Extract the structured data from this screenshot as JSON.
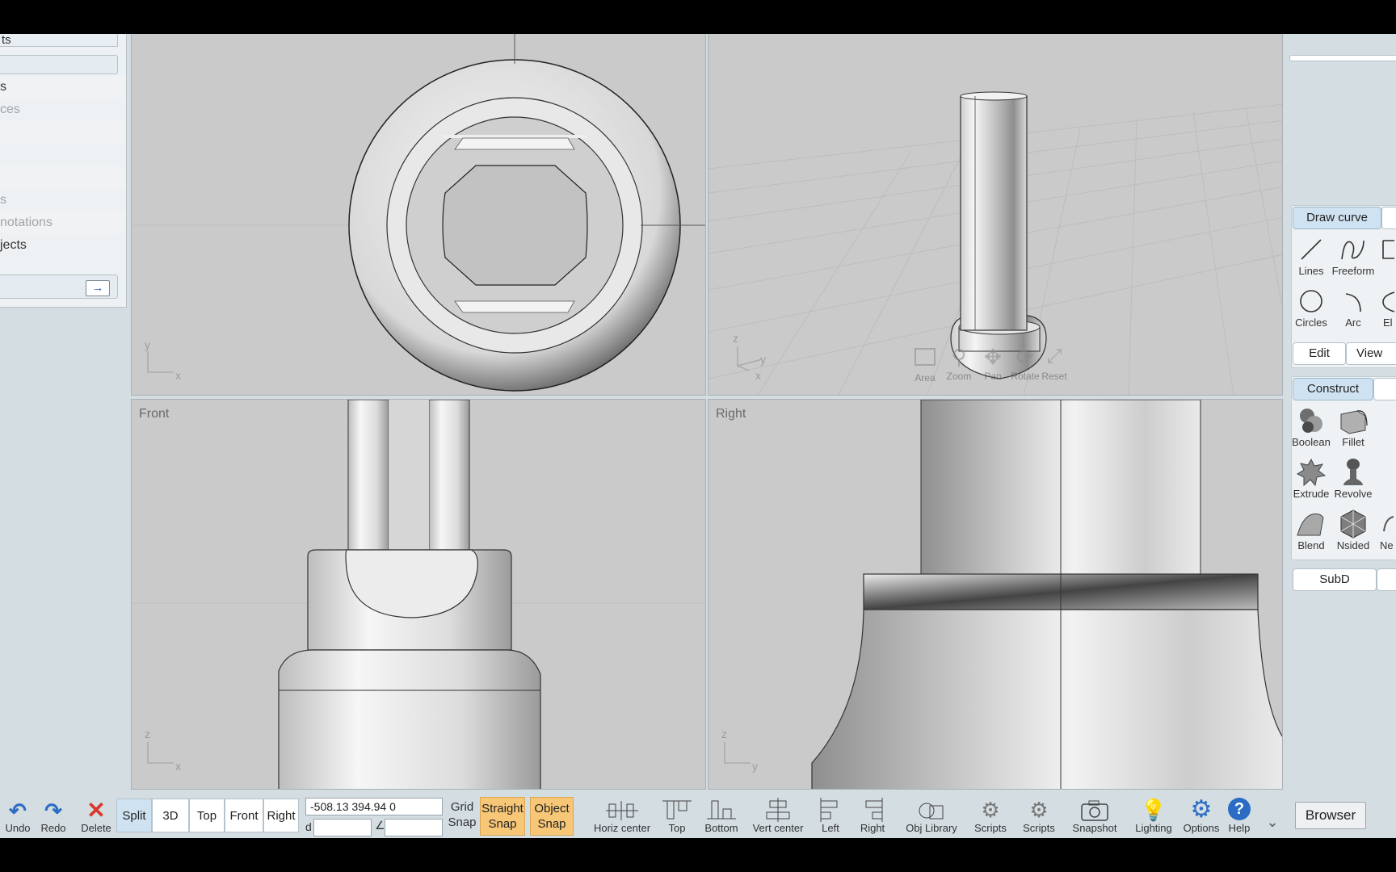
{
  "left_panel": {
    "tab_top": "ts",
    "rows": [
      "s",
      "ces",
      "",
      "",
      "",
      "s",
      "notations",
      "jects"
    ],
    "arrow": "→"
  },
  "viewports": {
    "top_left": {
      "label": "",
      "axis_x": "x",
      "axis_y": "y"
    },
    "top_right": {
      "label": "",
      "axis_x": "x",
      "axis_y": "y",
      "axis_z": "z",
      "nav": {
        "area": "Area",
        "zoom": "Zoom",
        "pan": "Pan",
        "rotate": "Rotate",
        "reset": "Reset"
      }
    },
    "front": {
      "label": "Front",
      "axis_x": "x",
      "axis_z": "z"
    },
    "right": {
      "label": "Right",
      "axis_y": "y",
      "axis_z": "z"
    }
  },
  "right_panel": {
    "draw_curve": "Draw curve",
    "draw_tools": [
      {
        "label": "Lines",
        "icon": "lines-icon"
      },
      {
        "label": "Freeform",
        "icon": "freeform-icon"
      },
      {
        "label": "Circles",
        "icon": "circles-icon"
      },
      {
        "label": "Arc",
        "icon": "arc-icon"
      },
      {
        "label": "El",
        "icon": "ellipse-icon"
      }
    ],
    "edit": "Edit",
    "view": "View",
    "construct": "Construct",
    "construct_tools": [
      {
        "label": "Boolean",
        "icon": "boolean-icon"
      },
      {
        "label": "Fillet",
        "icon": "fillet-icon"
      },
      {
        "label": "Extrude",
        "icon": "extrude-icon"
      },
      {
        "label": "Revolve",
        "icon": "revolve-icon"
      },
      {
        "label": "Blend",
        "icon": "blend-icon"
      },
      {
        "label": "Nsided",
        "icon": "nsided-icon"
      },
      {
        "label": "Ne",
        "icon": "network-icon"
      }
    ],
    "subd": "SubD"
  },
  "bottom_bar": {
    "undo": "Undo",
    "redo": "Redo",
    "delete": "Delete",
    "view_modes": [
      "Split",
      "3D",
      "Top",
      "Front",
      "Right"
    ],
    "coords": "-508.13   394.94    0",
    "distance_label": "d",
    "angle_label": "∠",
    "distance_value": "",
    "angle_value": "",
    "grid_snap": [
      "Grid",
      "Snap"
    ],
    "straight_snap": [
      "Straight",
      "Snap"
    ],
    "object_snap": [
      "Object",
      "Snap"
    ],
    "align": [
      "Horiz center",
      "Top",
      "Bottom",
      "Vert center",
      "Left",
      "Right"
    ],
    "tools": [
      "Obj Library",
      "Scripts",
      "Scripts",
      "Snapshot",
      "Lighting",
      "Options",
      "Help"
    ],
    "browser": "Browser"
  },
  "colors": {
    "panel_bg": "#d3dde2",
    "viewport_bg": "#cacaca",
    "selected_bg": "#cfe2f1",
    "snap_active": "#f7c777",
    "delete_red": "#d9372b",
    "icon_blue": "#2b6cc4"
  }
}
